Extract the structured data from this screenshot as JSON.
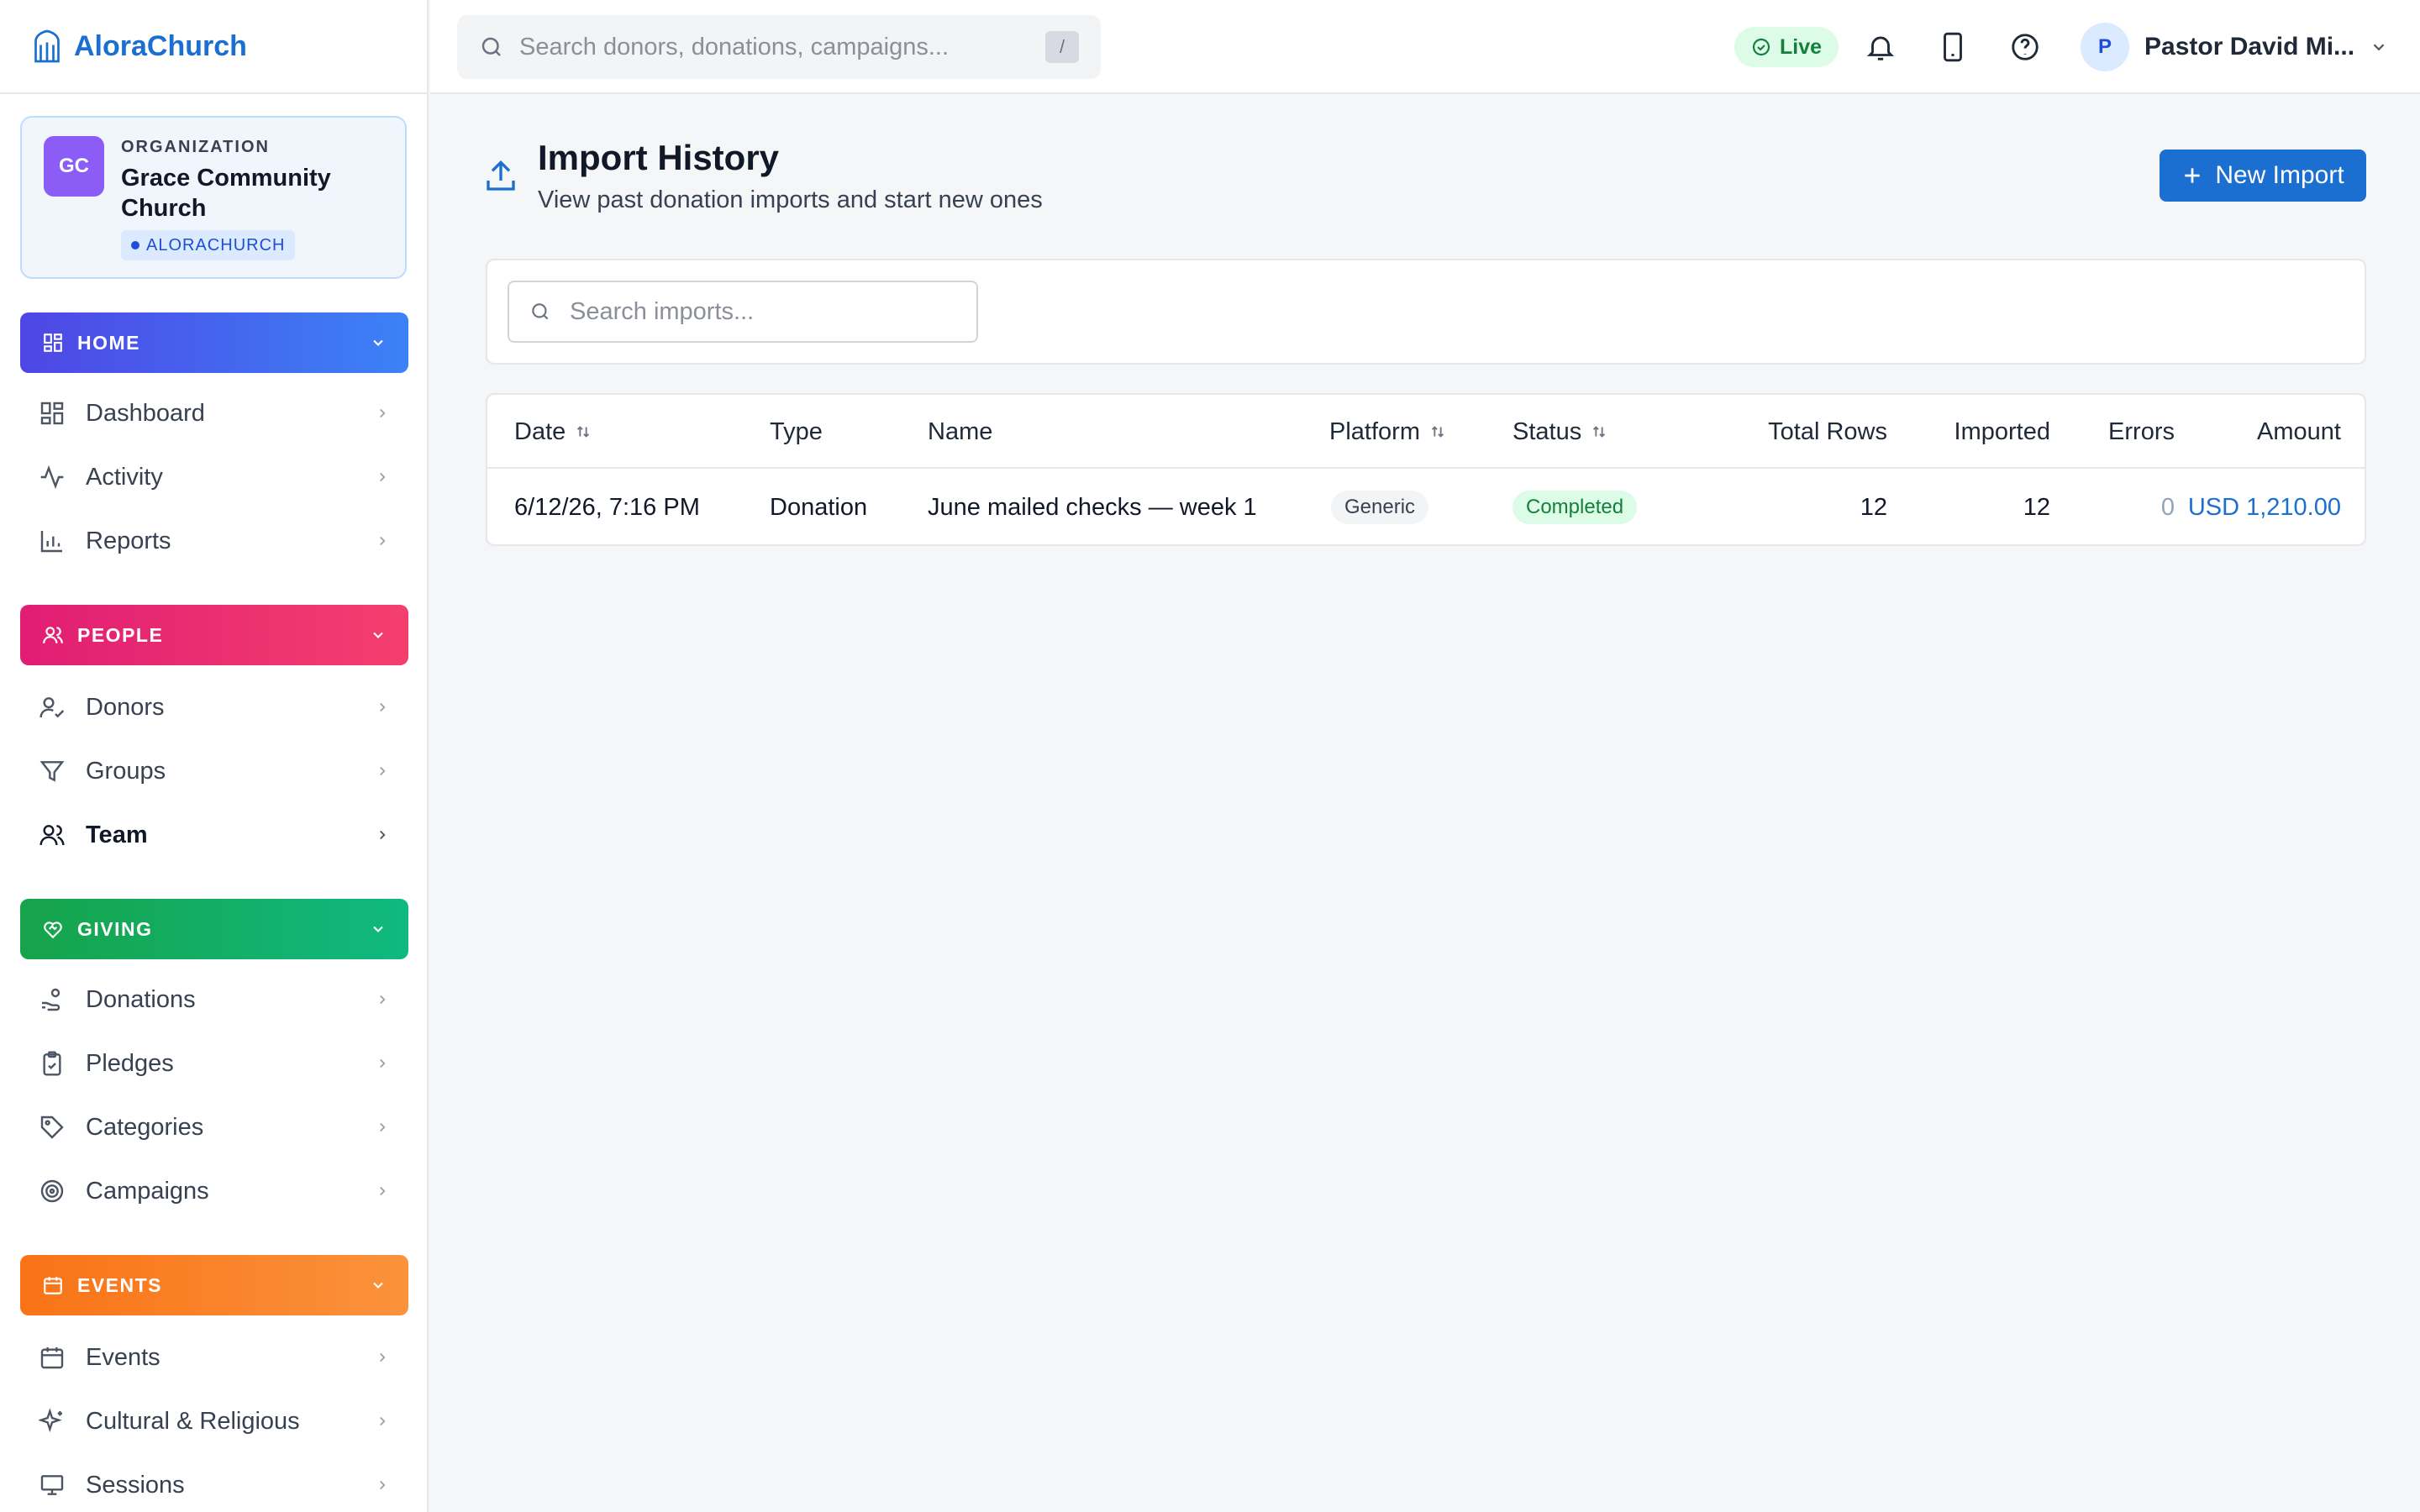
{
  "app": {
    "name": "AloraChurch"
  },
  "org": {
    "initials": "GC",
    "label": "ORGANIZATION",
    "name": "Grace Community Church",
    "tag": "ALORACHURCH"
  },
  "sidebar": {
    "sections": [
      {
        "label": "HOME",
        "color": "#4f46e5",
        "items": [
          {
            "label": "Dashboard"
          },
          {
            "label": "Activity"
          },
          {
            "label": "Reports"
          }
        ]
      },
      {
        "label": "PEOPLE",
        "color": "#e11d74",
        "items": [
          {
            "label": "Donors"
          },
          {
            "label": "Groups"
          },
          {
            "label": "Team",
            "active": true
          }
        ]
      },
      {
        "label": "GIVING",
        "color": "#16a34a",
        "items": [
          {
            "label": "Donations"
          },
          {
            "label": "Pledges"
          },
          {
            "label": "Categories"
          },
          {
            "label": "Campaigns"
          }
        ]
      },
      {
        "label": "EVENTS",
        "color": "#f97316",
        "items": [
          {
            "label": "Events"
          },
          {
            "label": "Cultural & Religious"
          },
          {
            "label": "Sessions"
          }
        ]
      }
    ]
  },
  "topbar": {
    "search_placeholder": "Search donors, donations, campaigns...",
    "search_shortcut": "/",
    "live_label": "Live",
    "user": {
      "initial": "P",
      "name": "Pastor David Mi..."
    }
  },
  "page": {
    "title": "Import History",
    "subtitle": "View past donation imports and start new ones",
    "new_import_label": "New Import",
    "search_placeholder": "Search imports..."
  },
  "table": {
    "columns": [
      {
        "label": "Date",
        "sortable": true
      },
      {
        "label": "Type"
      },
      {
        "label": "Name"
      },
      {
        "label": "Platform",
        "sortable": true
      },
      {
        "label": "Status",
        "sortable": true
      },
      {
        "label": "Total Rows"
      },
      {
        "label": "Imported"
      },
      {
        "label": "Errors"
      },
      {
        "label": "Amount"
      }
    ],
    "rows": [
      {
        "date": "6/12/26, 7:16 PM",
        "type": "Donation",
        "name": "June mailed checks — week 1",
        "platform": "Generic",
        "status": "Completed",
        "total_rows": "12",
        "imported": "12",
        "errors": "0",
        "amount": "USD 1,210.00"
      }
    ]
  },
  "colors": {
    "accent": "#1a6fd1",
    "success": "#15803d"
  }
}
